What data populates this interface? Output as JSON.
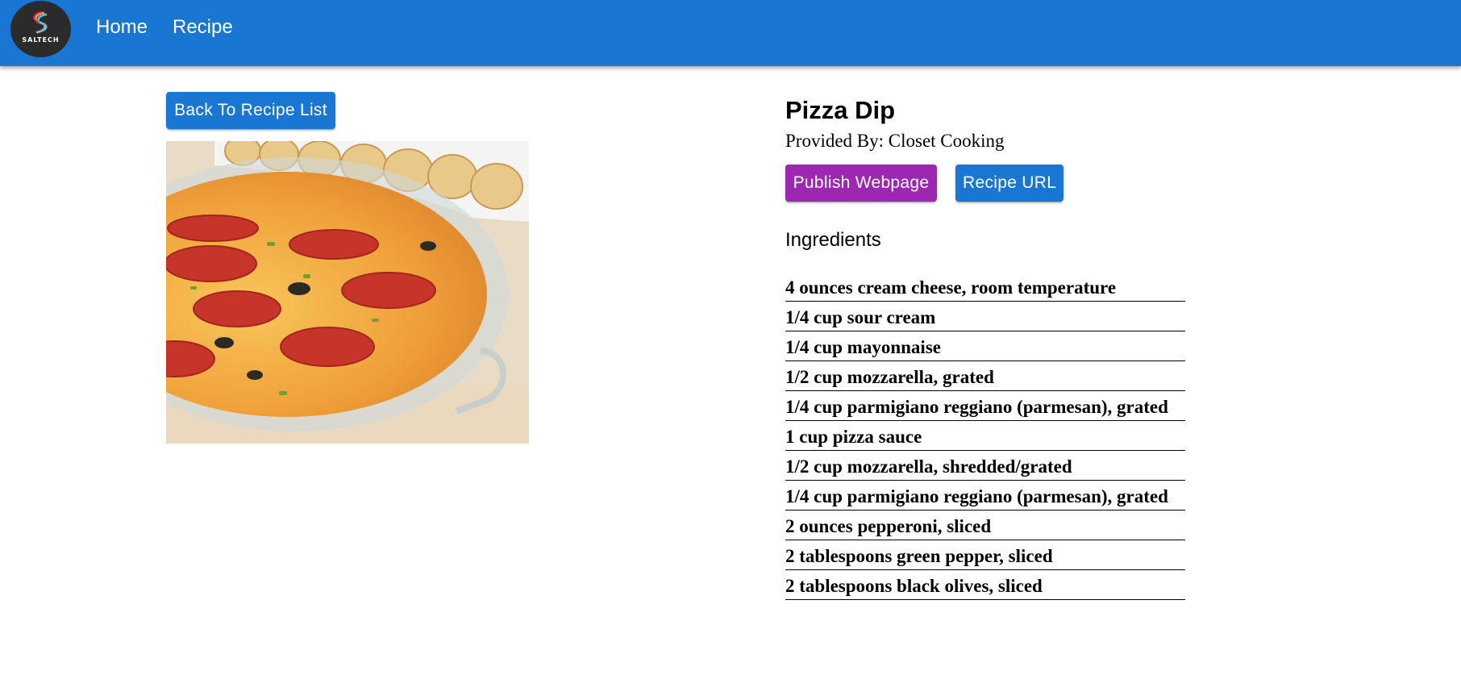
{
  "header": {
    "logo_text": "SALTECH",
    "nav": [
      {
        "label": "Home"
      },
      {
        "label": "Recipe"
      }
    ],
    "color": "#1976d2"
  },
  "actions": {
    "back_label": "Back To Recipe List",
    "publish_label": "Publish Webpage",
    "url_label": "Recipe URL"
  },
  "recipe": {
    "title": "Pizza Dip",
    "provider": "Provided By: Closet Cooking",
    "ingredients_heading": "Ingredients",
    "ingredients": [
      "4 ounces cream cheese, room temperature",
      "1/4 cup sour cream",
      "1/4 cup mayonnaise",
      "1/2 cup mozzarella, grated",
      "1/4 cup parmigiano reggiano (parmesan), grated",
      "1 cup pizza sauce",
      "1/2 cup mozzarella, shredded/grated",
      "1/4 cup parmigiano reggiano (parmesan), grated",
      "2 ounces pepperoni, sliced",
      "2 tablespoons green pepper, sliced",
      "2 tablespoons black olives, sliced"
    ]
  },
  "colors": {
    "primary": "#1976d2",
    "secondary": "#9c27b0"
  }
}
